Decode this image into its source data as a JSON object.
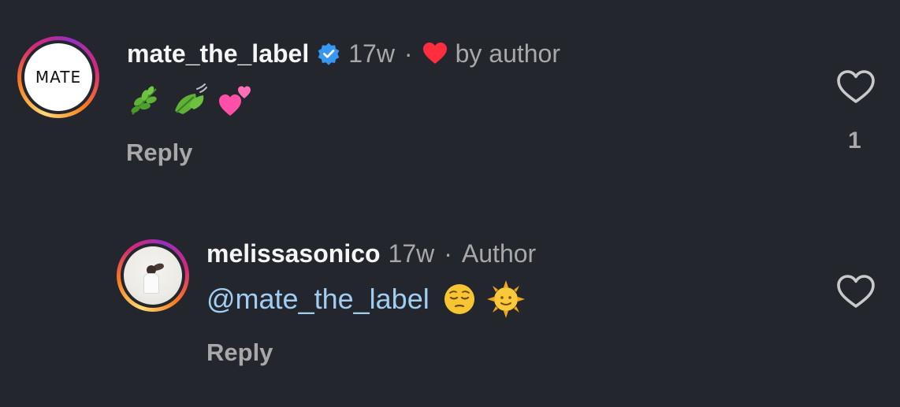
{
  "comments": [
    {
      "avatar_text": "MATE",
      "username": "mate_the_label",
      "verified": true,
      "time": "17w",
      "author_like_label": "by author",
      "emojis": [
        "herb",
        "leaf-fluttering-in-wind",
        "two-hearts"
      ],
      "reply_label": "Reply",
      "like_count": "1"
    },
    {
      "username": "melissasonico",
      "time": "17w",
      "author_badge": "Author",
      "mention": "@mate_the_label",
      "emojis": [
        "pensive-face",
        "sun-with-face"
      ],
      "reply_label": "Reply"
    }
  ],
  "icons": {
    "verified_color": "#3897f0",
    "author_heart_color": "#ff2d3d",
    "like_heart_color": "#c9c9c9"
  },
  "colors": {
    "background": "#23262d",
    "username": "#f5f5f5",
    "meta": "#a8a8a8",
    "mention": "#a0cdf2"
  }
}
